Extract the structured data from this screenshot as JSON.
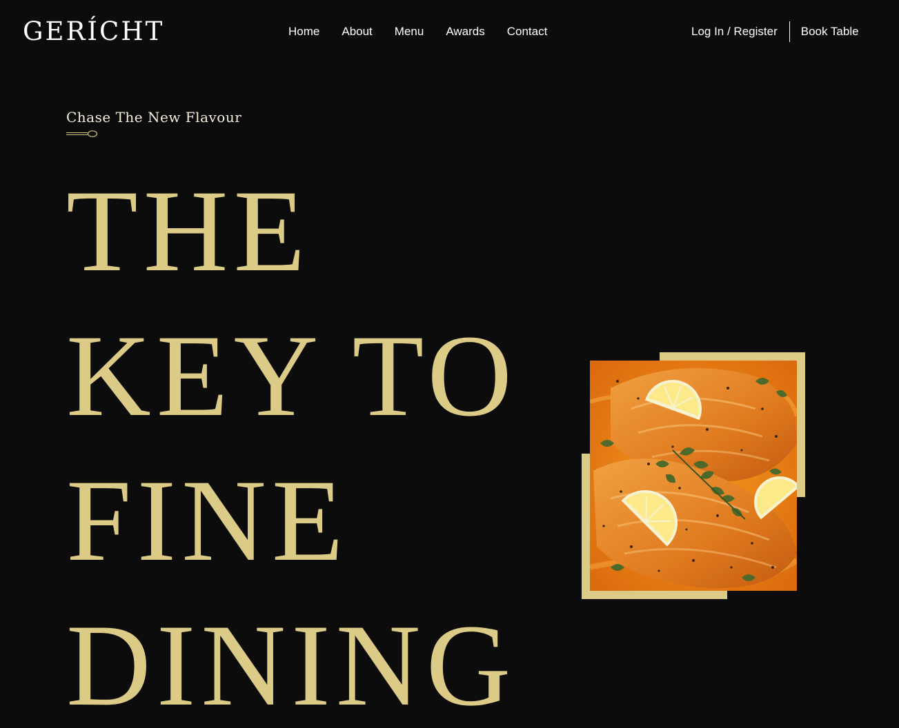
{
  "brand": {
    "logo": "GERÍCHT"
  },
  "nav": {
    "links": [
      "Home",
      "About",
      "Menu",
      "Awards",
      "Contact"
    ],
    "login": "Log In / Register",
    "book": "Book Table"
  },
  "hero": {
    "subtitle": "Chase The New Flavour",
    "headline": [
      "THE",
      "KEY TO",
      "FINE",
      "DINING"
    ],
    "image_alt": "salmon-with-lemon-and-herbs"
  },
  "colors": {
    "background": "#0c0c0c",
    "gold": "#dcca87",
    "white": "#ffffff"
  },
  "icons": {
    "spoon": "spoon-icon"
  }
}
